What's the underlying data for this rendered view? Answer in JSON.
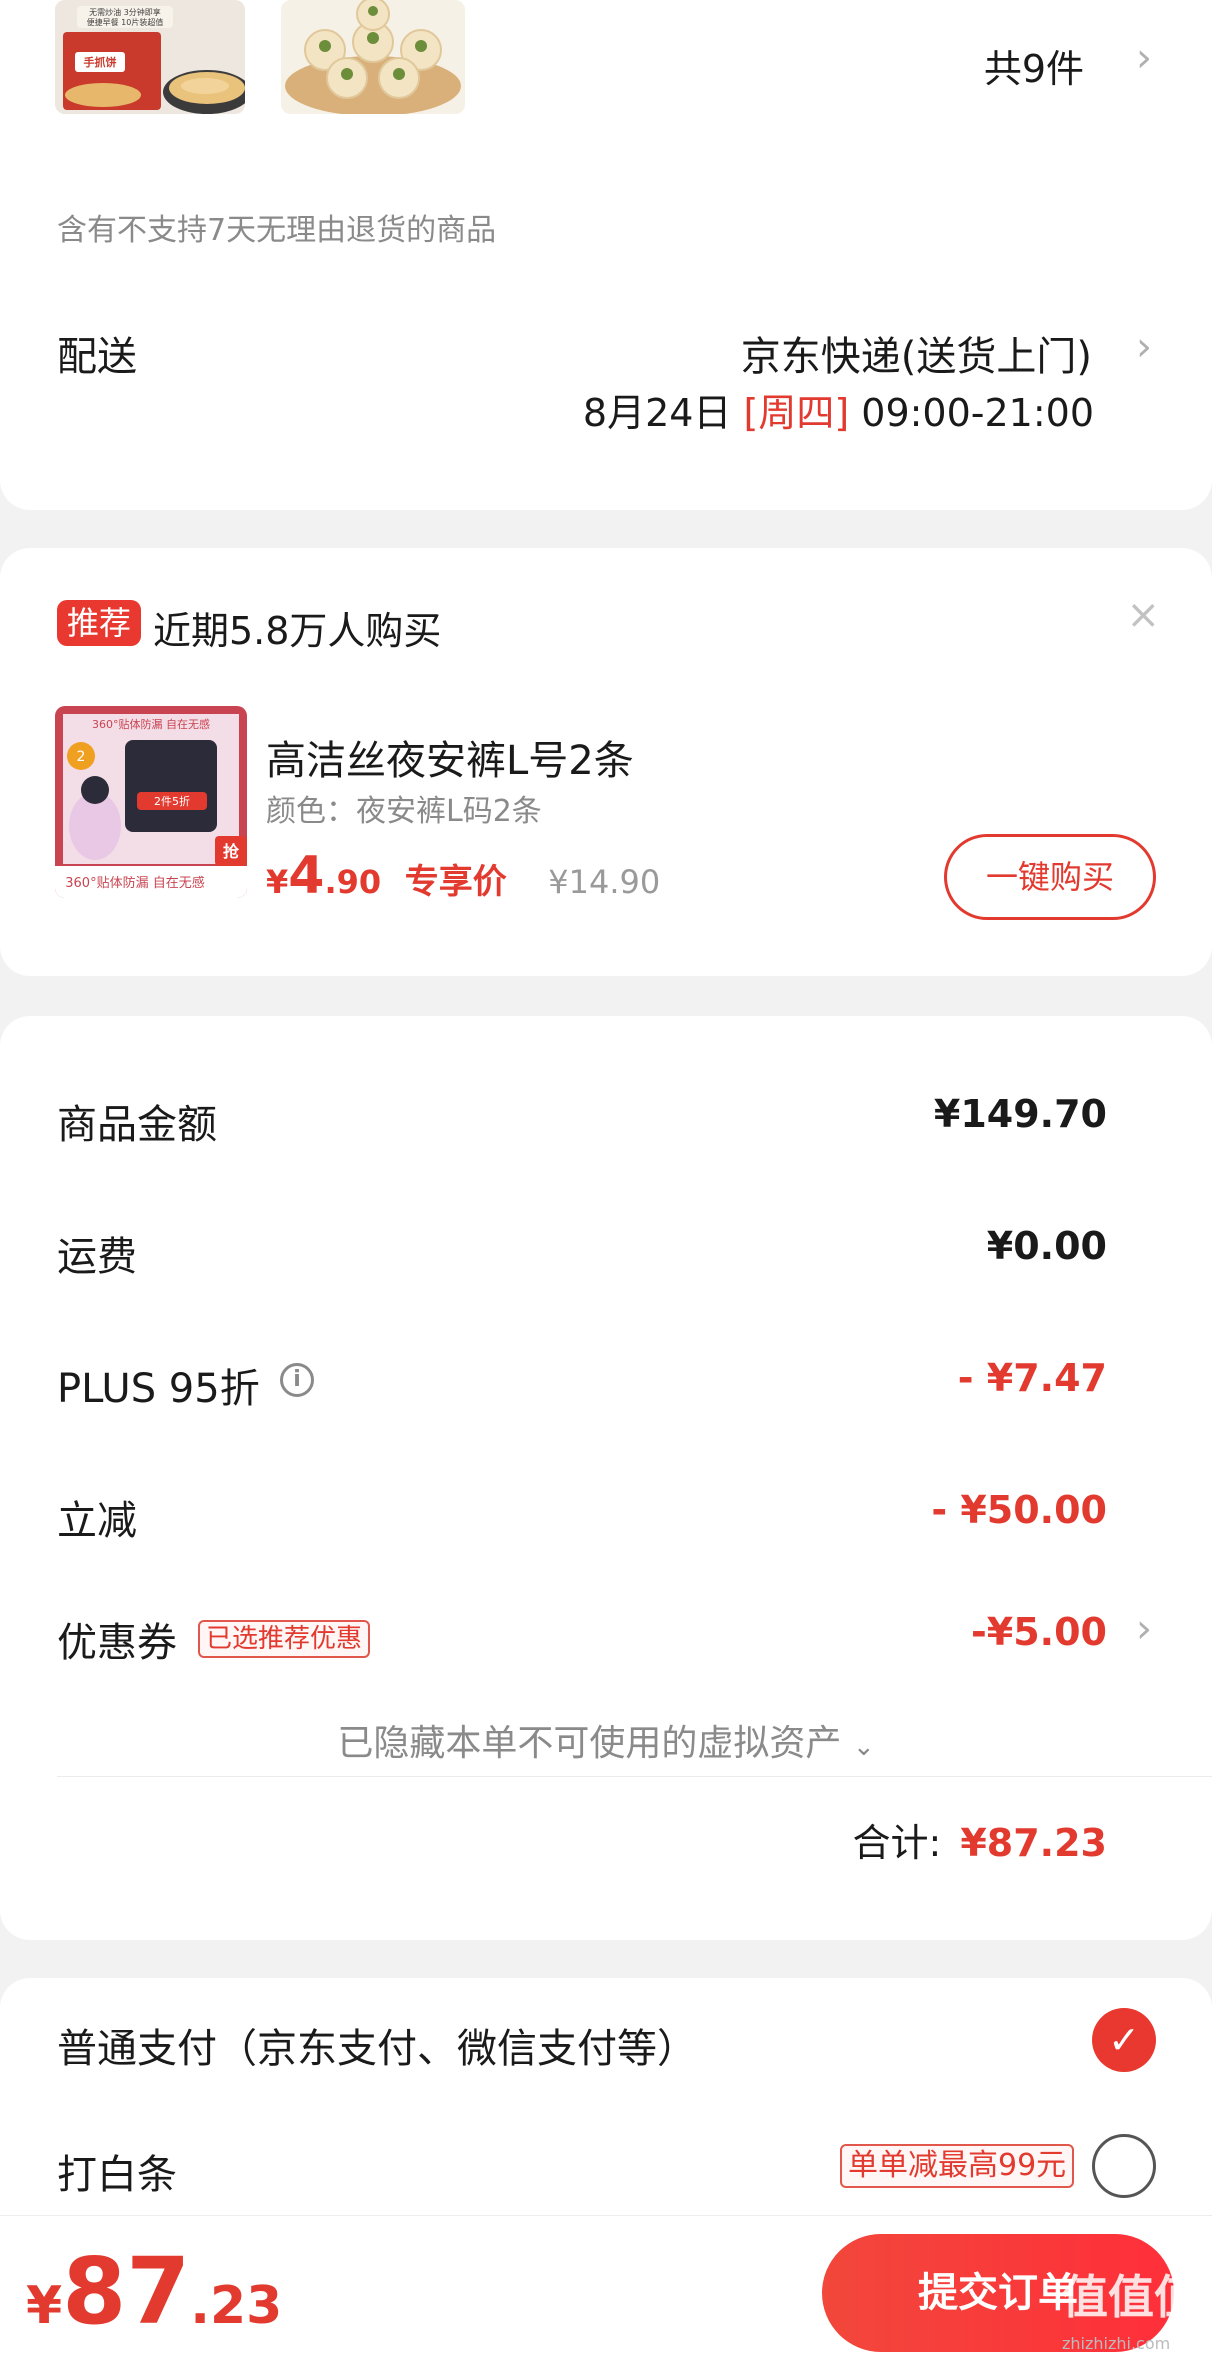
{
  "order_items": {
    "count_label": "共9件",
    "return_notice": "含有不支持7天无理由退货的商品",
    "product1_pack_text_1": "无需炒油 3分钟即享",
    "product1_pack_text_2": "便捷早餐 10片装超值",
    "product1_pack_brand": "手抓饼"
  },
  "delivery": {
    "label": "配送",
    "method": "京东快递(送货上门)",
    "date": "8月24日",
    "weekday": "[周四]",
    "time": "09:00-21:00"
  },
  "recommend": {
    "tag": "推荐",
    "headline": "近期5.8万人购买",
    "product_name": "高洁丝夜安裤L号2条",
    "spec": "颜色：夜安裤L码2条",
    "price_symbol": "¥",
    "price_int": "4",
    "price_dec": ".90",
    "price_note": "专享价",
    "original_price": "¥14.90",
    "buy_button": "一键购买",
    "img_text_1": "360°贴体防漏  自在无感",
    "img_text_2": "2件5折",
    "img_text_3": "抢",
    "img_text_4": "360°贴体防漏 自在无感",
    "img_badge_2": "2"
  },
  "summary": {
    "goods_label": "商品金额",
    "goods_value": "¥149.70",
    "shipping_label": "运费",
    "shipping_value": "¥0.00",
    "plus_label": "PLUS 95折",
    "plus_value": "- ¥7.47",
    "discount_label": "立减",
    "discount_value": "- ¥50.00",
    "coupon_label": "优惠券",
    "coupon_badge": "已选推荐优惠",
    "coupon_value": "-¥5.00",
    "hidden_assets": "已隐藏本单不可使用的虚拟资产",
    "total_label": "合计:",
    "total_value": "¥87.23"
  },
  "payment": {
    "normal_label": "普通支付（京东支付、微信支付等）",
    "baitiao_label": "打白条",
    "baitiao_badge": "单单减最高99元"
  },
  "bottom_bar": {
    "price_symbol": "¥",
    "price_int": "87",
    "price_dec": ".23",
    "submit_label": "提交订单",
    "watermark": "值值值",
    "watermark_sub": "zhizhizhi.com"
  },
  "colors": {
    "accent": "#e23a2f",
    "background": "#f2f2f2",
    "card": "#ffffff"
  }
}
